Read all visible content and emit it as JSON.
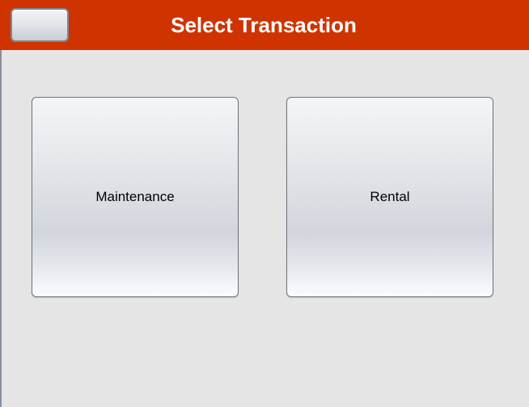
{
  "header": {
    "title": "Select Transaction",
    "back_button_label": "",
    "background_color": "#cf3400",
    "title_color": "#ffffff"
  },
  "tiles": [
    {
      "label": "Maintenance"
    },
    {
      "label": "Rental"
    }
  ],
  "colors": {
    "page_background": "#e5e5e5",
    "tile_border": "#6e737b"
  }
}
